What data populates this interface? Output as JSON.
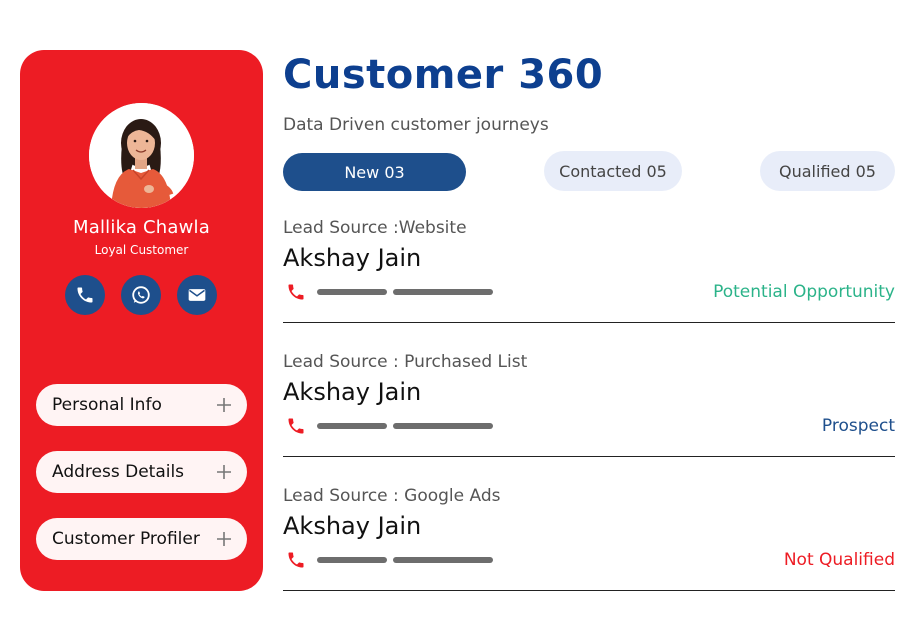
{
  "profile": {
    "name": "Mallika Chawla",
    "role": "Loyal Customer",
    "contacts": [
      {
        "icon": "phone-icon"
      },
      {
        "icon": "whatsapp-icon"
      },
      {
        "icon": "mail-icon"
      }
    ],
    "sections": [
      {
        "label": "Personal Info"
      },
      {
        "label": "Address Details"
      },
      {
        "label": "Customer Profiler"
      }
    ]
  },
  "main": {
    "title": "Customer 360",
    "subtitle": "Data Driven customer journeys",
    "tabs": [
      {
        "label": "New 03",
        "active": true
      },
      {
        "label": "Contacted 05",
        "active": false
      },
      {
        "label": "Qualified 05",
        "active": false
      }
    ],
    "leads": [
      {
        "source": "Lead Source :Website",
        "name": "Akshay Jain",
        "status": "Potential Opportunity",
        "status_color": "#2bb389"
      },
      {
        "source": "Lead Source : Purchased List",
        "name": "Akshay Jain",
        "status": "Prospect",
        "status_color": "#1e4f8c"
      },
      {
        "source": "Lead Source : Google Ads",
        "name": "Akshay Jain",
        "status": "Not Qualified",
        "status_color": "#ed1c24"
      }
    ]
  },
  "colors": {
    "card": "#ed1c24",
    "brand_blue": "#1e4f8c",
    "title_blue": "#0d3f8f"
  }
}
